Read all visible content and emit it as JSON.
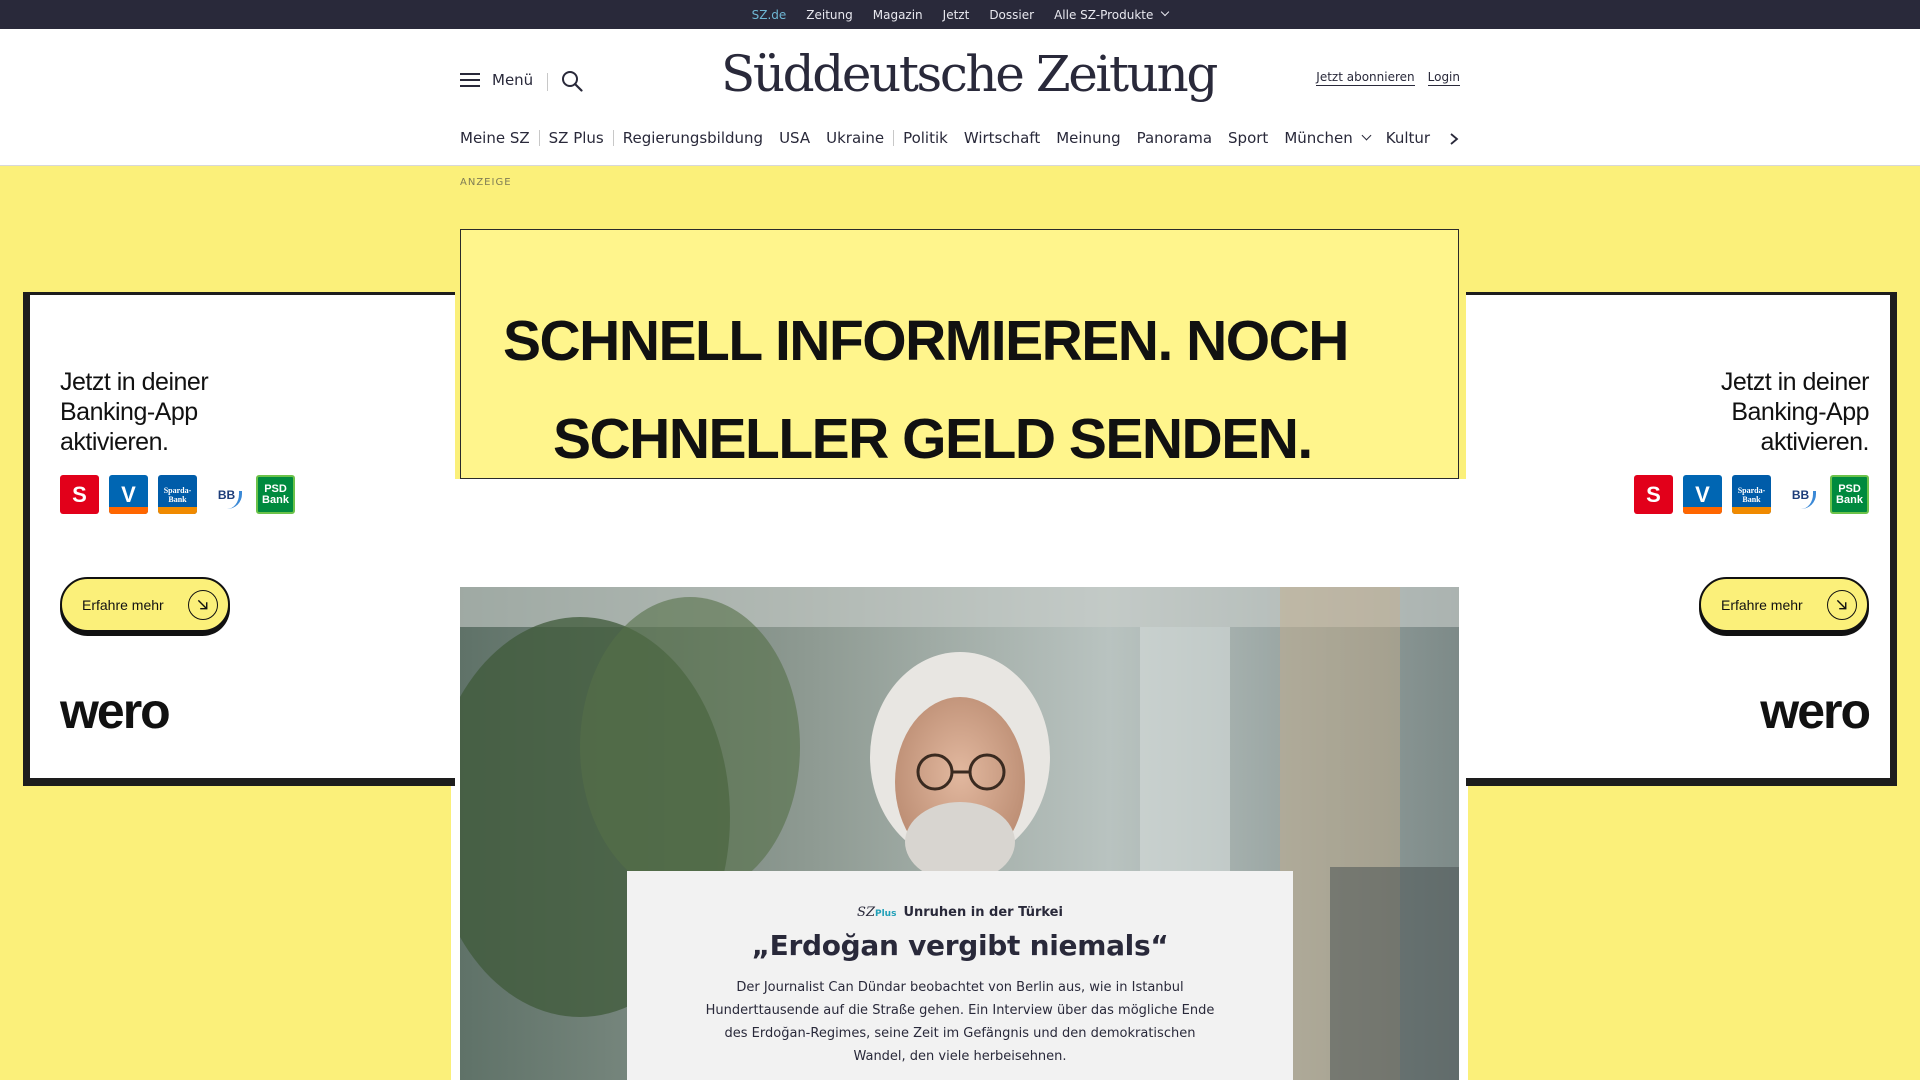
{
  "topbar": {
    "items": [
      {
        "label": "SZ.de",
        "active": true
      },
      {
        "label": "Zeitung"
      },
      {
        "label": "Magazin"
      },
      {
        "label": "Jetzt"
      },
      {
        "label": "Dossier"
      },
      {
        "label": "Alle SZ-Produkte"
      }
    ]
  },
  "header": {
    "menu_label": "Menü",
    "logo": "Süddeutsche Zeitung",
    "subscribe_label": "Jetzt abonnieren",
    "login_label": "Login"
  },
  "catnav": {
    "items": [
      "Meine SZ",
      "SZ Plus",
      "Regierungsbildung",
      "USA",
      "Ukraine",
      "Politik",
      "Wirtschaft",
      "Meinung",
      "Panorama",
      "Sport",
      "München",
      "Kultur"
    ]
  },
  "ad": {
    "label": "ANZEIGE",
    "headline_1": "SCHNELL INFORMIEREN. NOCH",
    "headline_2": "SCHNELLER GELD SENDEN.",
    "side_copy_1": "Jetzt in deiner",
    "side_copy_2": "Banking-App",
    "side_copy_3": "aktivieren.",
    "cta": "Erfahre mehr",
    "brand": "wero",
    "banks": [
      "S",
      "V",
      "Sparda-Bank",
      "BB",
      "PSD Bank"
    ],
    "bg_color": "#fbf07a"
  },
  "teaser": {
    "brand_sz": "SZ",
    "brand_plus": "Plus",
    "kicker": "Unruhen in der  Türkei",
    "headline": "„Erdoğan vergibt niemals“",
    "lead": "Der Journalist Can Dündar beobachtet von Berlin aus, wie in Istanbul Hunderttausende auf die Straße gehen. Ein Interview über das mögliche Ende des Erdoğan-Regimes, seine Zeit im Gefängnis und den demokratischen Wandel, den viele herbeisehnen."
  },
  "colors": {
    "ink": "#29293a",
    "accent": "#21a0b8"
  }
}
